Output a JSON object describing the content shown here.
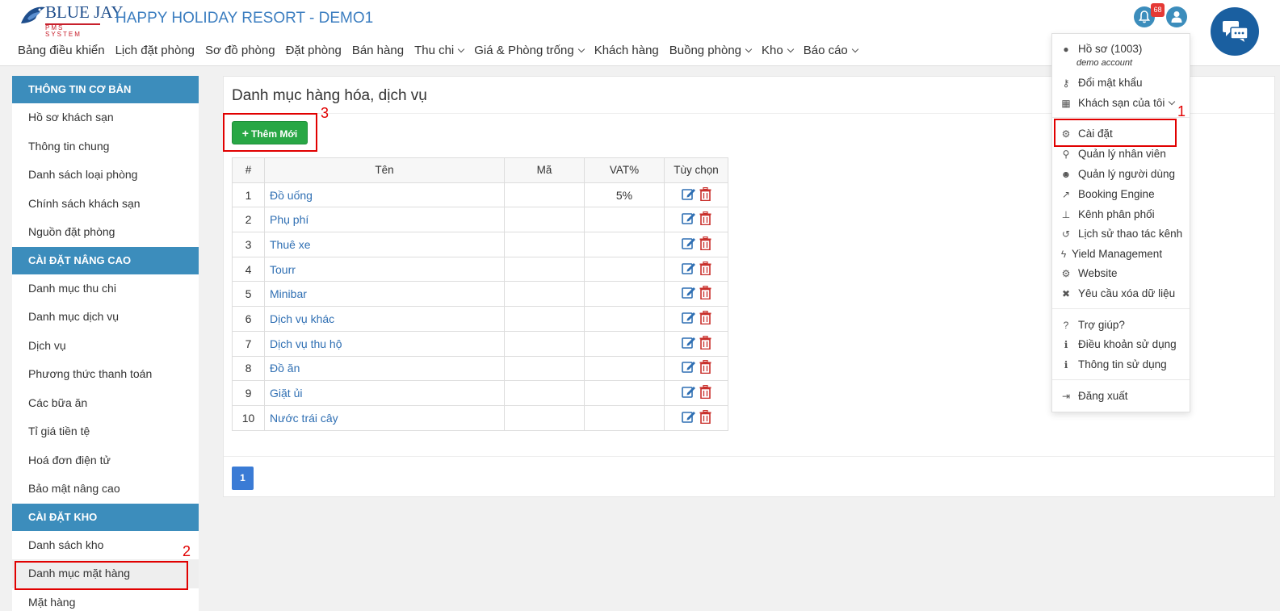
{
  "brand": {
    "line1": "BLUE JAY",
    "line2": "PMS SYSTEM",
    "hotel_name": "HAPPY HOLIDAY RESORT - DEMO1"
  },
  "nav": {
    "items": [
      {
        "label": "Bảng điều khiển",
        "caret": false
      },
      {
        "label": "Lịch đặt phòng",
        "caret": false
      },
      {
        "label": "Sơ đồ phòng",
        "caret": false
      },
      {
        "label": "Đặt phòng",
        "caret": false
      },
      {
        "label": "Bán hàng",
        "caret": false
      },
      {
        "label": "Thu chi",
        "caret": true
      },
      {
        "label": "Giá & Phòng trống",
        "caret": true
      },
      {
        "label": "Khách hàng",
        "caret": false
      },
      {
        "label": "Buồng phòng",
        "caret": true
      },
      {
        "label": "Kho",
        "caret": true
      },
      {
        "label": "Báo cáo",
        "caret": true
      }
    ]
  },
  "notifications": {
    "count": "68"
  },
  "sidebar": {
    "sections": [
      {
        "title": "THÔNG TIN CƠ BẢN",
        "items": [
          "Hồ sơ khách sạn",
          "Thông tin chung",
          "Danh sách loại phòng",
          "Chính sách khách sạn",
          "Nguồn đặt phòng"
        ]
      },
      {
        "title": "CÀI ĐẶT NÂNG CAO",
        "items": [
          "Danh mục thu chi",
          "Danh mục dịch vụ",
          "Dịch vụ",
          "Phương thức thanh toán",
          "Các bữa ăn",
          "Tỉ giá tiền tệ",
          "Hoá đơn điện tử",
          "Bảo mật nâng cao"
        ]
      },
      {
        "title": "CÀI ĐẶT KHO",
        "items": [
          "Danh sách kho",
          "Danh mục mặt hàng",
          "Mặt hàng"
        ]
      }
    ],
    "active": "Danh mục mặt hàng"
  },
  "main": {
    "title": "Danh mục hàng hóa, dịch vụ",
    "add_button": "Thêm Mới",
    "table": {
      "headers": [
        "#",
        "Tên",
        "Mã",
        "VAT%",
        "Tùy chọn"
      ],
      "rows": [
        {
          "num": "1",
          "name": "Đồ uống",
          "code": "",
          "vat": "5%"
        },
        {
          "num": "2",
          "name": "Phụ phí",
          "code": "",
          "vat": ""
        },
        {
          "num": "3",
          "name": "Thuê xe",
          "code": "",
          "vat": ""
        },
        {
          "num": "4",
          "name": "Tourr",
          "code": "",
          "vat": ""
        },
        {
          "num": "5",
          "name": "Minibar",
          "code": "",
          "vat": ""
        },
        {
          "num": "6",
          "name": "Dịch vụ khác",
          "code": "",
          "vat": ""
        },
        {
          "num": "7",
          "name": "Dịch vụ thu hộ",
          "code": "",
          "vat": ""
        },
        {
          "num": "8",
          "name": "Đồ ăn",
          "code": "",
          "vat": ""
        },
        {
          "num": "9",
          "name": "Giặt ủi",
          "code": "",
          "vat": ""
        },
        {
          "num": "10",
          "name": "Nước trái cây",
          "code": "",
          "vat": ""
        }
      ]
    },
    "pagination": {
      "current": "1"
    }
  },
  "user_menu": {
    "profile": "Hồ sơ  (1003)",
    "account": "demo account",
    "change_password": "Đổi mật khẩu",
    "my_hotels": "Khách sạn của tôi",
    "settings": "Cài đặt",
    "staff": "Quản lý nhân viên",
    "users": "Quản lý người dùng",
    "booking_engine": "Booking Engine",
    "channels": "Kênh phân phối",
    "channel_history": "Lịch sử thao tác kênh",
    "yield": "Yield Management",
    "website": "Website",
    "delete_data": "Yêu cầu xóa dữ liệu",
    "help": "Trợ giúp?",
    "terms": "Điều khoản sử dụng",
    "usage_info": "Thông tin sử dụng",
    "logout": "Đăng xuất"
  },
  "annotations": {
    "one": "1",
    "two": "2",
    "three": "3"
  },
  "colors": {
    "brand_blue": "#3c8dbc",
    "link": "#2f6fb3",
    "add_green": "#28a745",
    "annotation_red": "#e10000"
  }
}
